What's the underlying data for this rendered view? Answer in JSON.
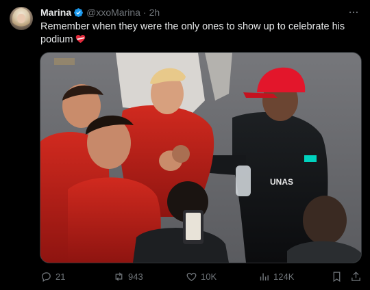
{
  "author": {
    "display_name": "Marina",
    "handle": "@xxoMarina",
    "separator": "·",
    "time": "2h",
    "verified": true
  },
  "tweet": {
    "text": "Remember when they were the only ones to show up to celebrate his podium",
    "emoji": "heart-ribbon"
  },
  "media": {
    "description_icon": "photo"
  },
  "actions": {
    "replies": "21",
    "reposts": "943",
    "likes": "10K",
    "views": "124K"
  },
  "colors": {
    "background": "#000000",
    "text": "#e7e9ea",
    "muted": "#71767b",
    "verified": "#1d9bf0",
    "border": "#2f3336"
  }
}
